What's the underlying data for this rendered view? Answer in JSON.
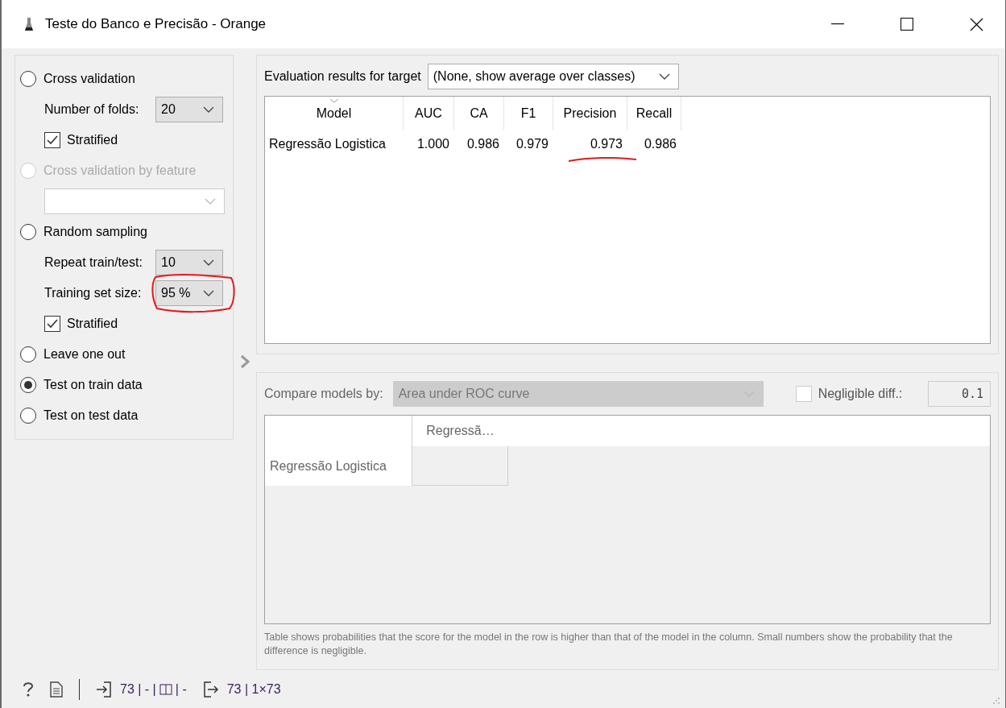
{
  "window": {
    "title": "Teste do Banco e Precisão - Orange"
  },
  "sampling": [
    {
      "kind": "radio",
      "label": "Cross validation",
      "selected": false,
      "disabled": false
    },
    {
      "kind": "combo",
      "label": "Number of folds:",
      "value": "20",
      "disabled": false,
      "circled": false
    },
    {
      "kind": "check",
      "label": "Stratified",
      "checked": true
    },
    {
      "kind": "radio",
      "label": "Cross validation by feature",
      "selected": false,
      "disabled": true
    },
    {
      "kind": "combo",
      "disabled": true,
      "circled": false
    },
    {
      "kind": "radio",
      "label": "Random sampling",
      "selected": false,
      "disabled": false
    },
    {
      "kind": "combo",
      "label": "Repeat train/test:",
      "value": "10",
      "disabled": false,
      "circled": false
    },
    {
      "kind": "combo",
      "label": "Training set size:",
      "value": "95 %",
      "disabled": false,
      "circled": true
    },
    {
      "kind": "check",
      "label": "Stratified",
      "checked": true
    },
    {
      "kind": "radio",
      "label": "Leave one out",
      "selected": false,
      "disabled": false
    },
    {
      "kind": "radio",
      "label": "Test on train data",
      "selected": true,
      "disabled": false
    },
    {
      "kind": "radio",
      "label": "Test on test data",
      "selected": false,
      "disabled": false
    }
  ],
  "results": {
    "target_label": "Evaluation results for target",
    "target_value": "(None, show average over classes)",
    "columns": [
      "Model",
      "AUC",
      "CA",
      "F1",
      "Precision",
      "Recall"
    ],
    "rows": [
      {
        "cells": [
          {
            "text": "Regressão Logistica",
            "underlined": false
          },
          {
            "text": "1.000",
            "underlined": false
          },
          {
            "text": "0.986",
            "underlined": false
          },
          {
            "text": "0.979",
            "underlined": false
          },
          {
            "text": "0.973",
            "underlined": true
          },
          {
            "text": "0.986",
            "underlined": false
          }
        ]
      }
    ]
  },
  "compare": {
    "label": "Compare models by:",
    "value": "Area under ROC curve",
    "disabled": true,
    "negligible": {
      "label": "Negligible diff.:",
      "checked": false,
      "value": "0.1"
    },
    "columns": [
      "Regressã…"
    ],
    "rows": [
      "Regressão Logistica"
    ],
    "note": "Table shows probabilities that the score for the model in the row is higher than that of the model in the column. Small numbers show the probability that the difference is negligible."
  },
  "status_bar": {
    "input": "73 | - |",
    "input_extra": "| -",
    "output": "73 | 1×73"
  }
}
